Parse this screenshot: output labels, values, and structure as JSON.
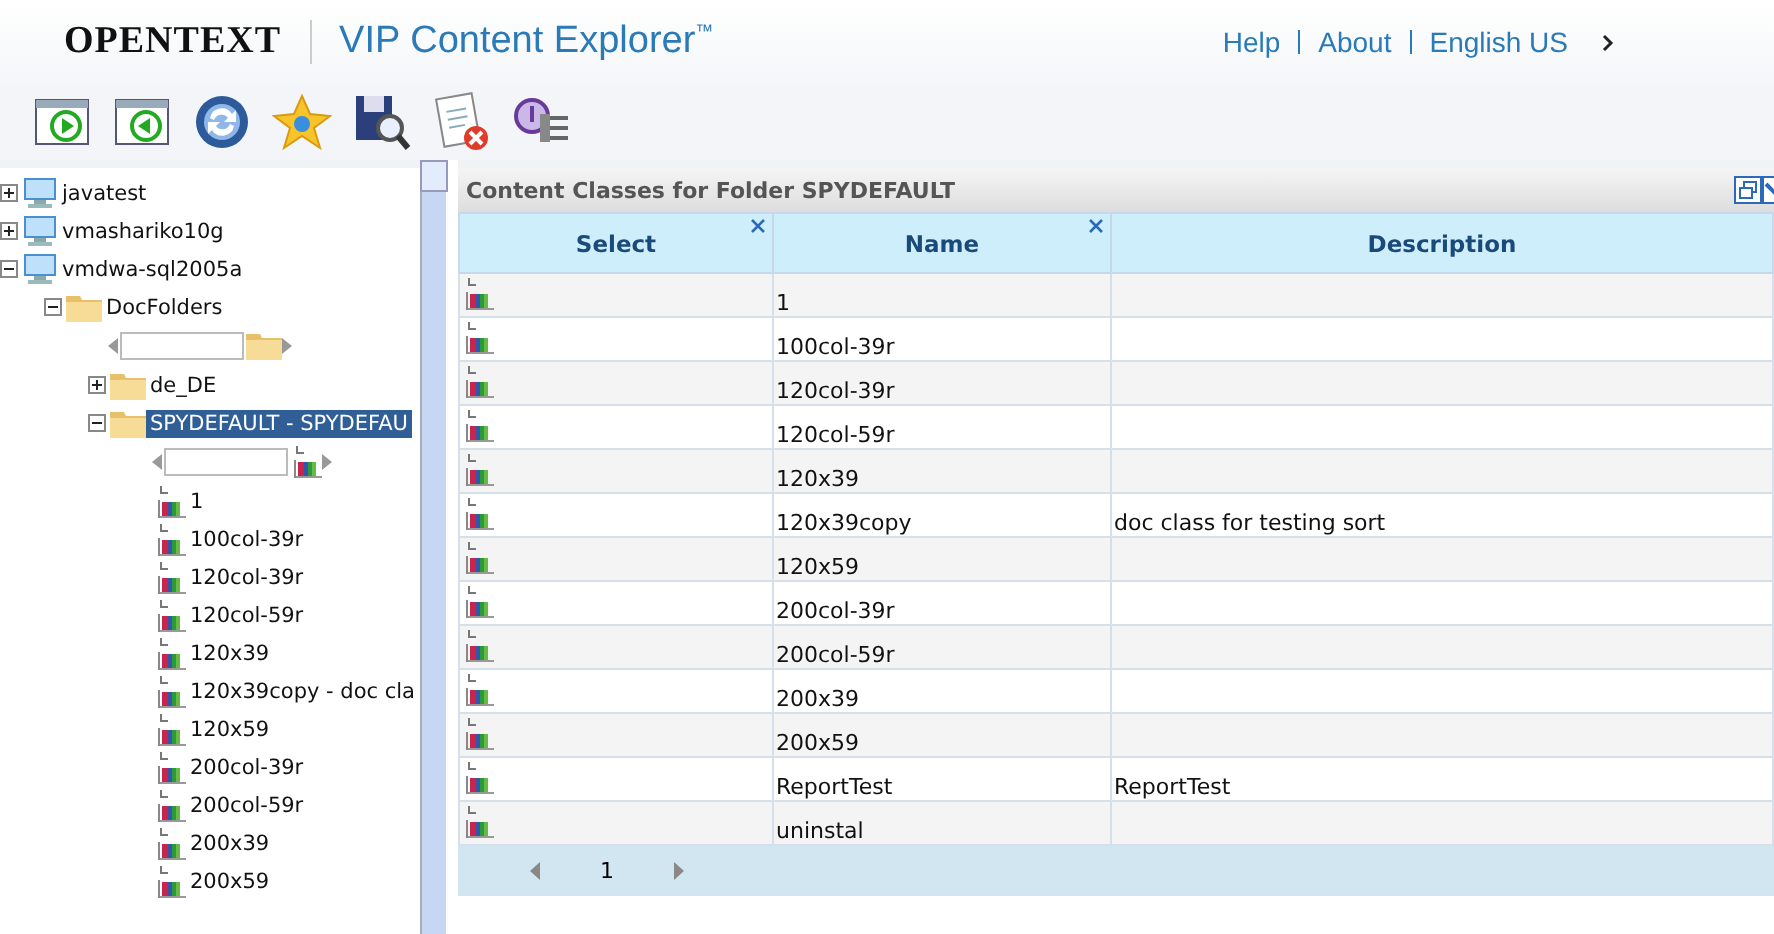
{
  "header": {
    "brand": "OPENTEXT",
    "product": "VIP Content Explorer$^{™}$",
    "links": [
      "Help",
      "About",
      "English US"
    ]
  },
  "tree": {
    "items": [
      {
        "kind": "server",
        "label": "javatest",
        "expanded": false,
        "selected": false
      },
      {
        "kind": "server",
        "label": "vmashariko10g",
        "expanded": false,
        "selected": false
      },
      {
        "kind": "server",
        "label": "vmdwa-sql2005a",
        "expanded": true,
        "selected": false,
        "children": [
          {
            "kind": "folder",
            "label": "DocFolders",
            "expanded": true,
            "selected": false,
            "children": [
              {
                "kind": "folder_scroller"
              },
              {
                "kind": "folder",
                "label": "de_DE",
                "expanded": false,
                "selected": false
              },
              {
                "kind": "folder",
                "label": "SPYDEFAULT - SPYDEFAU",
                "expanded": true,
                "selected": true,
                "children": [
                  {
                    "kind": "class_scroller"
                  },
                  {
                    "kind": "class",
                    "label": "1"
                  },
                  {
                    "kind": "class",
                    "label": "100col-39r"
                  },
                  {
                    "kind": "class",
                    "label": "120col-39r"
                  },
                  {
                    "kind": "class",
                    "label": "120col-59r"
                  },
                  {
                    "kind": "class",
                    "label": "120x39"
                  },
                  {
                    "kind": "class",
                    "label": "120x39copy - doc cla"
                  },
                  {
                    "kind": "class",
                    "label": "120x59"
                  },
                  {
                    "kind": "class",
                    "label": "200col-39r"
                  },
                  {
                    "kind": "class",
                    "label": "200col-59r"
                  },
                  {
                    "kind": "class",
                    "label": "200x39"
                  },
                  {
                    "kind": "class",
                    "label": "200x59"
                  }
                ]
              }
            ]
          }
        ]
      }
    ]
  },
  "panel": {
    "title": "Content Classes for Folder  SPYDEFAULT",
    "table": {
      "columns": [
        {
          "label": "Select",
          "closable": true
        },
        {
          "label": "Name",
          "closable": true
        },
        {
          "label": "Description",
          "closable": false
        }
      ],
      "rows": [
        {
          "name": "1"
        },
        {
          "name": "100col-39r"
        },
        {
          "name": "120col-39r"
        },
        {
          "name": "120col-59r"
        },
        {
          "name": "120x39"
        },
        {
          "name": "120x39copy",
          "description": "doc class for testing sort"
        },
        {
          "name": "120x59"
        },
        {
          "name": "200col-39r"
        },
        {
          "name": "200col-59r"
        },
        {
          "name": "200x39"
        },
        {
          "name": "200x59"
        },
        {
          "name": "ReportTest",
          "description": "ReportTest"
        },
        {
          "name": "uninstal"
        }
      ]
    },
    "pager": {
      "page": "1"
    }
  }
}
